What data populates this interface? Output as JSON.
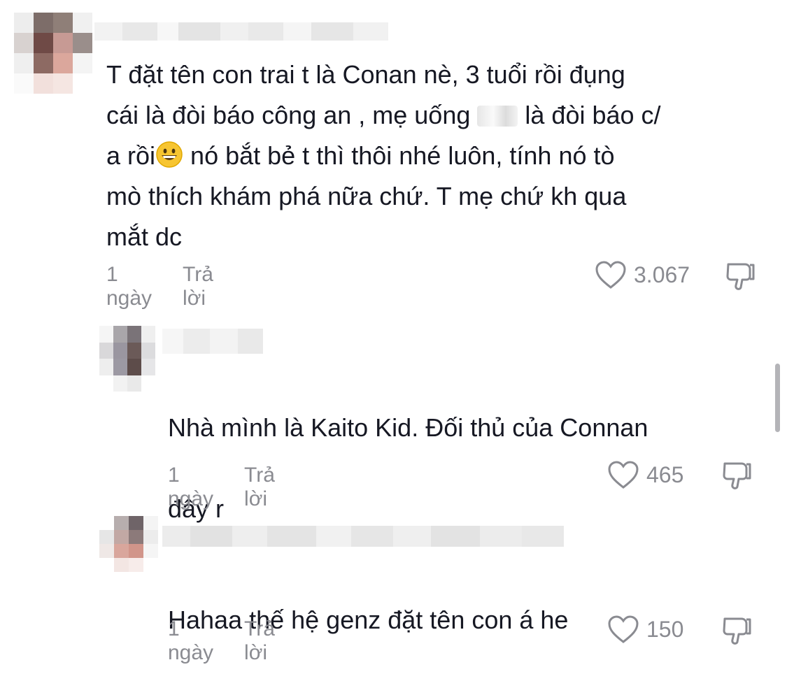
{
  "comments": [
    {
      "text_lines": [
        "T đặt tên con trai t là Conan nè, 3 tuổi rồi đụng",
        "cái là đòi báo công an , mẹ uống",
        "là đòi báo c/",
        "a rồi",
        "nó bắt bẻ t thì thôi nhé luôn, tính nó tò",
        "mò thích khám phá nữa chứ. T mẹ chứ kh qua",
        "mắt dc"
      ],
      "time": "1 ngày",
      "reply_label": "Trả lời",
      "likes": "3.067"
    },
    {
      "text_lines": [
        "Nhà mình là Kaito Kid. Đối thủ của Connan",
        "đây r"
      ],
      "time": "1 ngày",
      "reply_label": "Trả lời",
      "likes": "465"
    },
    {
      "text_lines": [
        "Hahaa thế hệ genz đặt tên con á he"
      ],
      "time": "1 ngày",
      "reply_label": "Trả lời",
      "likes": "150"
    }
  ],
  "icons": {
    "like": "heart-outline-icon",
    "dislike": "thumbs-down-icon",
    "emoji": "grinning-face-emoji"
  },
  "colors": {
    "text": "#161823",
    "meta": "#8a8b91"
  }
}
